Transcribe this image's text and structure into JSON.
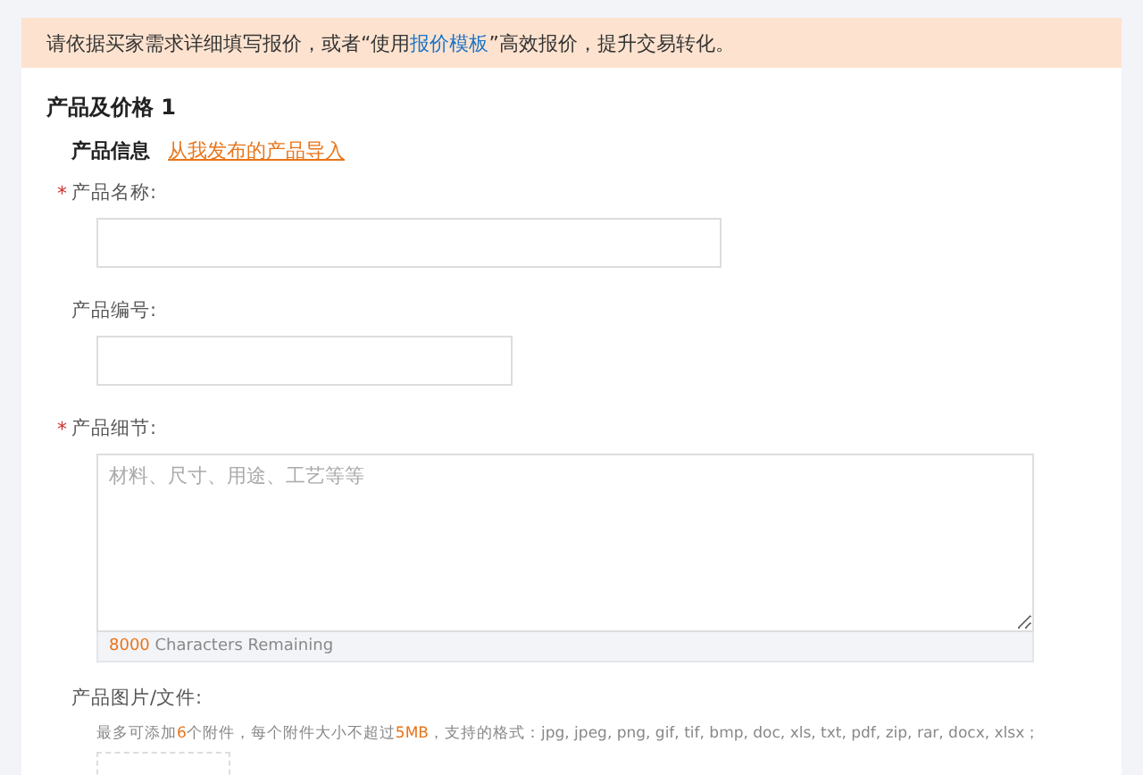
{
  "notice": {
    "before": "请依据买家需求详细填写报价，或者“使用",
    "link": "报价模板",
    "after": "”高效报价，提升交易转化。"
  },
  "section": {
    "title": "产品及价格 1",
    "subtitle": "产品信息",
    "import_link": "从我发布的产品导入"
  },
  "fields": [
    {
      "kind": "text",
      "label": "产品名称:",
      "required_mark": "*"
    },
    {
      "kind": "text",
      "label": "产品编号:"
    },
    {
      "kind": "textarea",
      "label": "产品细节:",
      "required_mark": "*",
      "placeholder": "材料、尺寸、用途、工艺等等",
      "count": "8000",
      "count_label": "Characters Remaining"
    }
  ],
  "attachments": {
    "label": "产品图片/文件:",
    "hint": [
      {
        "text": "最多可添加",
        "highlight": false
      },
      {
        "text": "6",
        "highlight": true
      },
      {
        "text": "个附件，每个附件大小不超过",
        "highlight": false
      },
      {
        "text": "5MB",
        "highlight": true
      },
      {
        "text": "，支持的格式：jpg, jpeg, png, gif, tif, bmp, doc, xls, txt, pdf, zip, rar, docx, xlsx；",
        "highlight": false
      }
    ]
  }
}
